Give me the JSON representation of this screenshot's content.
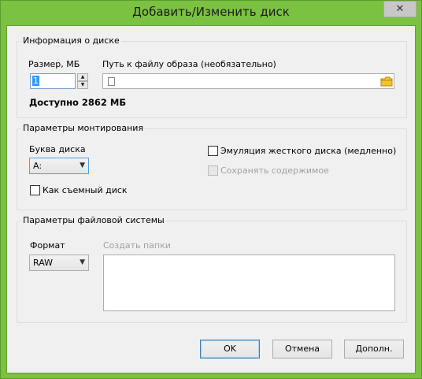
{
  "window": {
    "title": "Добавить/Изменить диск",
    "close_glyph": "✕"
  },
  "disk_info": {
    "legend": "Информация о диске",
    "size_label": "Размер, МБ",
    "size_value": "1",
    "path_label": "Путь к файлу образа (необязательно)",
    "path_value": "",
    "available_text": "Доступно 2862 МБ"
  },
  "mount": {
    "legend": "Параметры монтирования",
    "drive_letter_label": "Буква диска",
    "drive_letter_value": "A:",
    "removable_label": "Как съемный диск",
    "removable_checked": false,
    "hdd_emulation_label": "Эмуляция жесткого диска (медленно)",
    "hdd_emulation_checked": false,
    "keep_contents_label": "Сохранять содержимое",
    "keep_contents_enabled": false
  },
  "fs": {
    "legend": "Параметры файловой системы",
    "format_label": "Формат",
    "format_value": "RAW",
    "create_folders_label": "Создать папки"
  },
  "buttons": {
    "ok": "OK",
    "cancel": "Отмена",
    "more": "Дополн."
  },
  "colors": {
    "title_bar": "#7bc142",
    "client_bg": "#f0f0f0",
    "selection": "#3399ff"
  }
}
